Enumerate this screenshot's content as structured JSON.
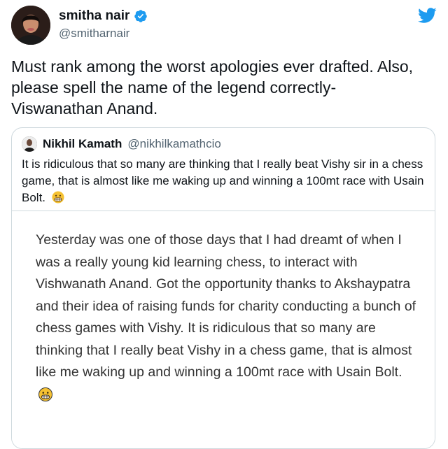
{
  "author": {
    "display_name": "smitha nair",
    "handle": "@smitharnair",
    "verified": true,
    "avatar_icon": "user-avatar-photo"
  },
  "tweet": {
    "text": "Must rank among the worst apologies ever drafted. Also, please spell the name of the legend correctly- Viswanathan Anand."
  },
  "quoted_tweet": {
    "display_name": "Nikhil Kamath",
    "handle": "@nikhilkamathcio",
    "text": "It is ridiculous that so many are thinking that I really beat Vishy sir in a chess game, that is almost like me waking up and winning a 100mt race with Usain Bolt.",
    "emoji": "grimacing-face",
    "image_text": "Yesterday was one of those days that I had dreamt of when I was a really young kid learning chess, to interact with Vishwanath Anand. Got the opportunity thanks to Akshaypatra and their idea of raising funds for charity conducting a bunch of chess games with Vishy. It is ridiculous that so many are thinking that I really beat Vishy in a chess game, that is almost like me waking up and winning a 100mt race with Usain Bolt."
  },
  "icons": {
    "brand": "twitter-bird-icon",
    "verified": "verified-badge-icon"
  },
  "colors": {
    "twitter_blue": "#1d9bf0",
    "text_primary": "#0f1419",
    "text_secondary": "#536471",
    "border": "#cfd9de"
  }
}
